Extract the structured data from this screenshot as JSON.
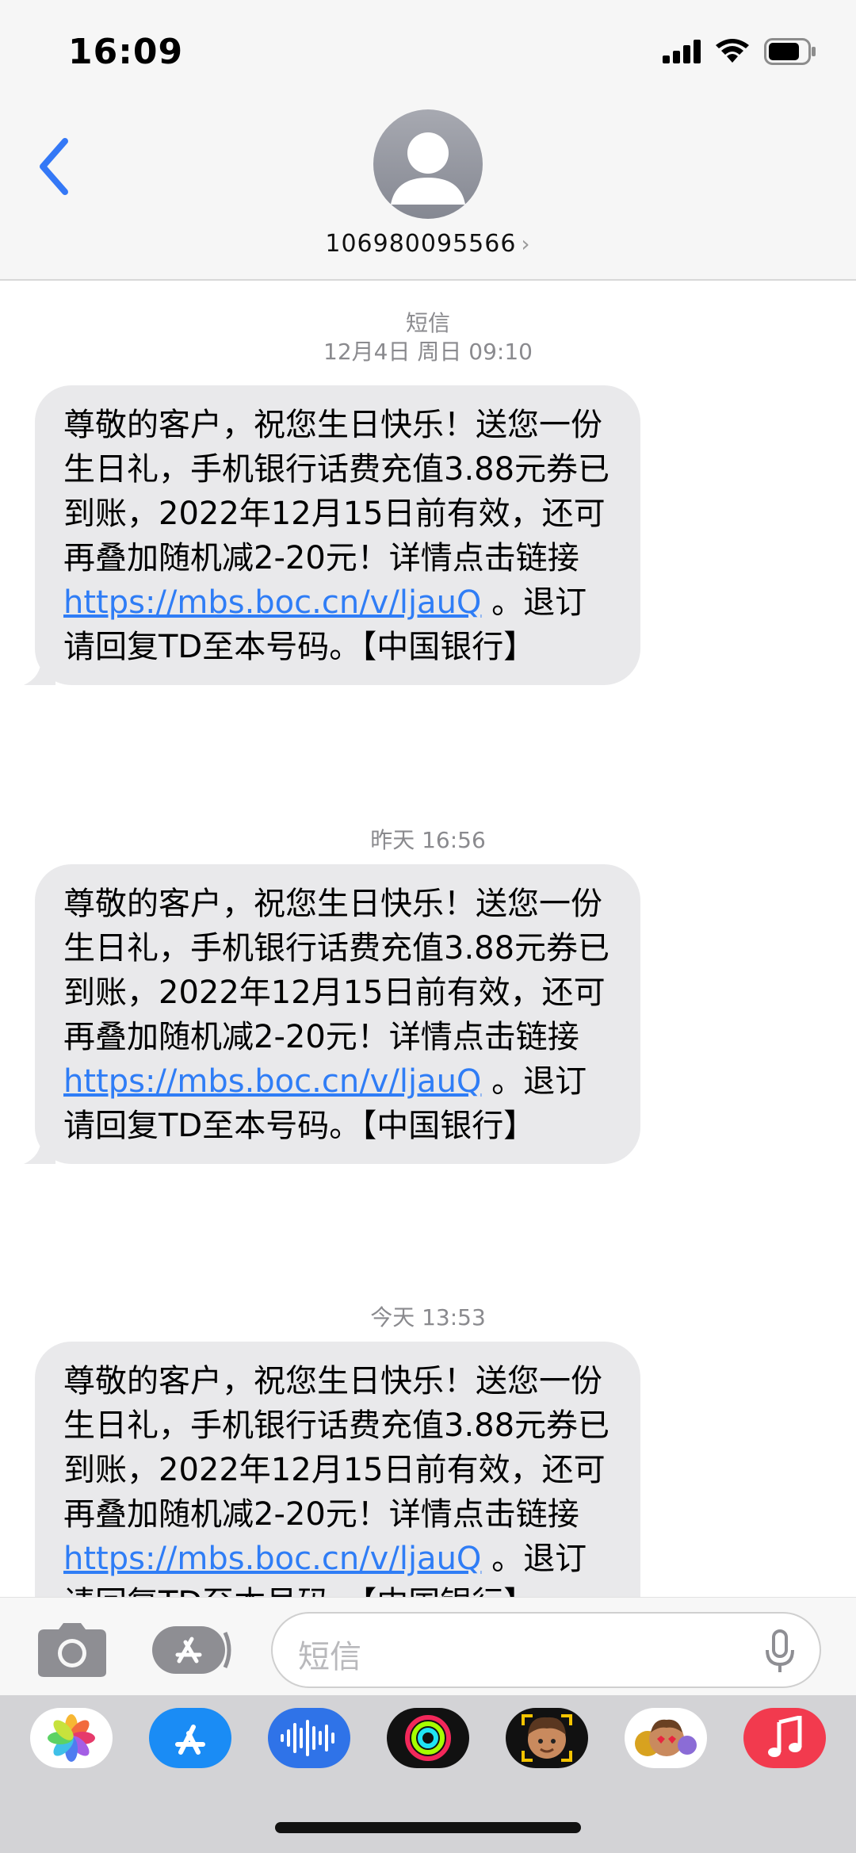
{
  "status_bar": {
    "time": "16:09"
  },
  "header": {
    "contact_number": "106980095566",
    "chevron": "›"
  },
  "thread": {
    "header_label": "短信",
    "messages": [
      {
        "timestamp": "12月4日 周日 09:10",
        "text_before": "尊敬的客户，祝您生日快乐！送您一份生日礼，手机银行话费充值3.88元券已到账，2022年12月15日前有效，还可再叠加随机减2-20元！详情点击链接",
        "link": "https://mbs.boc.cn/v/ljauQ",
        "text_after": " 。退订请回复TD至本号码。【中国银行】"
      },
      {
        "timestamp": "昨天 16:56",
        "text_before": "尊敬的客户，祝您生日快乐！送您一份生日礼，手机银行话费充值3.88元券已到账，2022年12月15日前有效，还可再叠加随机减2-20元！详情点击链接",
        "link": "https://mbs.boc.cn/v/ljauQ",
        "text_after": " 。退订请回复TD至本号码。【中国银行】"
      },
      {
        "timestamp": "今天 13:53",
        "text_before": "尊敬的客户，祝您生日快乐！送您一份生日礼，手机银行话费充值3.88元券已到账，2022年12月15日前有效，还可再叠加随机减2-20元！详情点击链接",
        "link": "https://mbs.boc.cn/v/ljauQ",
        "text_after": " 。退订请回复TD至本号码。【中国银行】"
      }
    ]
  },
  "compose": {
    "placeholder": "短信"
  },
  "app_drawer": {
    "apps": [
      "photos-icon",
      "appstore-icon",
      "audio-message-icon",
      "fitness-icon",
      "memoji-icon",
      "animoji-icon",
      "music-icon"
    ]
  },
  "colors": {
    "link": "#2f7df6",
    "back": "#3478f6",
    "bubble": "#e9e9eb"
  }
}
